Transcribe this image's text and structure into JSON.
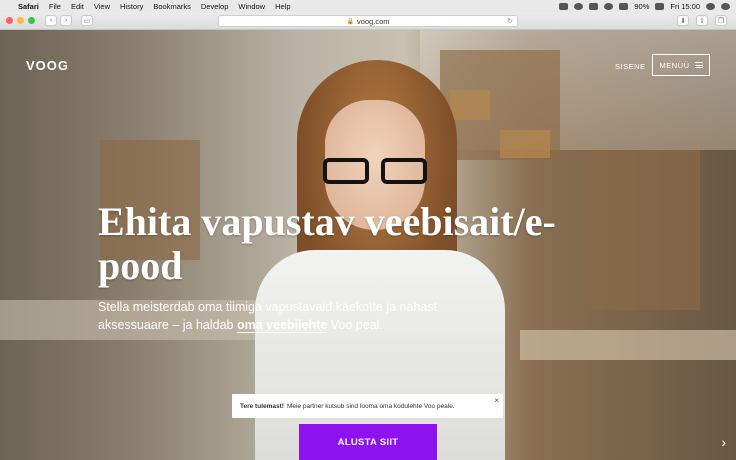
{
  "menubar": {
    "apple_icon": "apple-logo-icon",
    "items": [
      "Safari",
      "File",
      "Edit",
      "View",
      "History",
      "Bookmarks",
      "Develop",
      "Window",
      "Help"
    ],
    "battery": "90%",
    "clock": "Fri 15:00"
  },
  "browser": {
    "url": "voog.com"
  },
  "site": {
    "logo": "VOOG",
    "signin": "SISENE",
    "menu": "MENÜÜ",
    "headline": "Ehita vapustav veebisait/e-pood",
    "sub_prefix": "Stella meisterdab oma tiimiga vapustavaid käekotte ja nahast aksessuaare – ja haldab ",
    "sub_link": "oma veebilehte",
    "sub_suffix": " Voo peal.",
    "toast_bold": "Tere tulemast!",
    "toast_text": "Meie partner kutsub sind looma oma kodulehte Voo peale.",
    "toast_close": "×",
    "cta": "ALUSTA SIIT",
    "next": "›"
  },
  "colors": {
    "accent": "#8e11f0"
  }
}
